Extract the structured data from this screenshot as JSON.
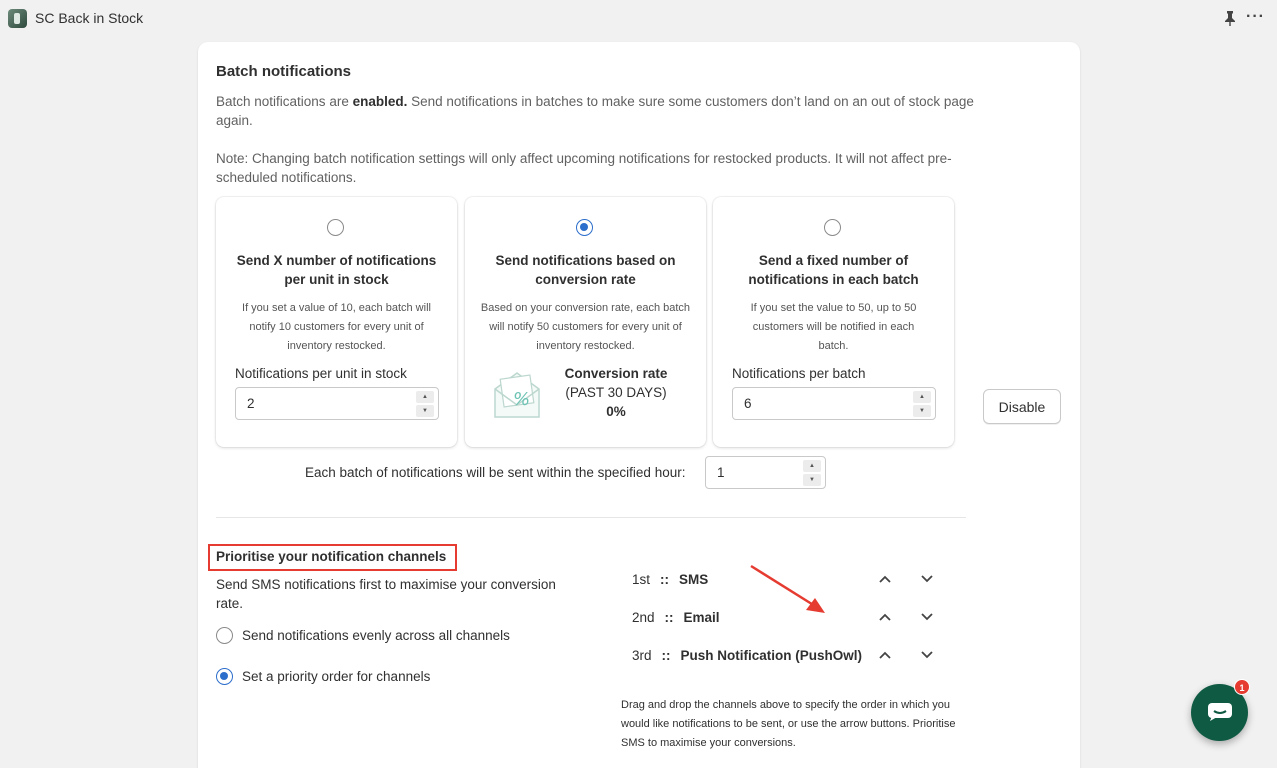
{
  "app": {
    "title": "SC Back in Stock"
  },
  "batch": {
    "title": "Batch notifications",
    "status_prefix": "Batch notifications are ",
    "status_word": "enabled.",
    "status_suffix": " Send notifications in batches to make sure some customers don’t land on an out of stock page again.",
    "note": "Note: Changing batch notification settings will only affect upcoming notifications for restocked products. It will not affect pre-scheduled notifications.",
    "options": [
      {
        "selected": false,
        "title": "Send X number of notifications per unit in stock",
        "description": "If you set a value of 10, each batch will notify 10 customers for every unit of inventory restocked.",
        "input_label": "Notifications per unit in stock",
        "input_value": "2"
      },
      {
        "selected": true,
        "title": "Send notifications based on conversion rate",
        "description": "Based on your conversion rate, each batch will notify 50 customers for every unit of inventory restocked.",
        "conversion_title": "Conversion rate",
        "conversion_period": "(PAST 30 DAYS)",
        "conversion_value": "0%"
      },
      {
        "selected": false,
        "title": "Send a fixed number of notifications in each batch",
        "description": "If you set the value to 50, up to 50 customers will be notified in each batch.",
        "input_label": "Notifications per batch",
        "input_value": "6"
      }
    ],
    "disable_label": "Disable",
    "hour_label": "Each batch of notifications will be sent within the specified hour:",
    "hour_value": "1"
  },
  "priority": {
    "title": "Prioritise your notification channels",
    "description": "Send SMS notifications first to maximise your conversion rate.",
    "options": [
      {
        "label": "Send notifications evenly across all channels",
        "selected": false
      },
      {
        "label": "Set a priority order for channels",
        "selected": true
      }
    ],
    "separator": "::",
    "channels": [
      {
        "rank": "1st",
        "name": "SMS"
      },
      {
        "rank": "2nd",
        "name": "Email"
      },
      {
        "rank": "3rd",
        "name": "Push Notification (PushOwl)"
      }
    ],
    "help": "Drag and drop the channels above to specify the order in which you would like notifications to be sent, or use the arrow buttons. Prioritise SMS to maximise your conversions."
  },
  "chat": {
    "badge": "1"
  },
  "colors": {
    "accent": "#2c6ecb",
    "highlight": "#e53b30",
    "chat": "#0f5a43"
  }
}
